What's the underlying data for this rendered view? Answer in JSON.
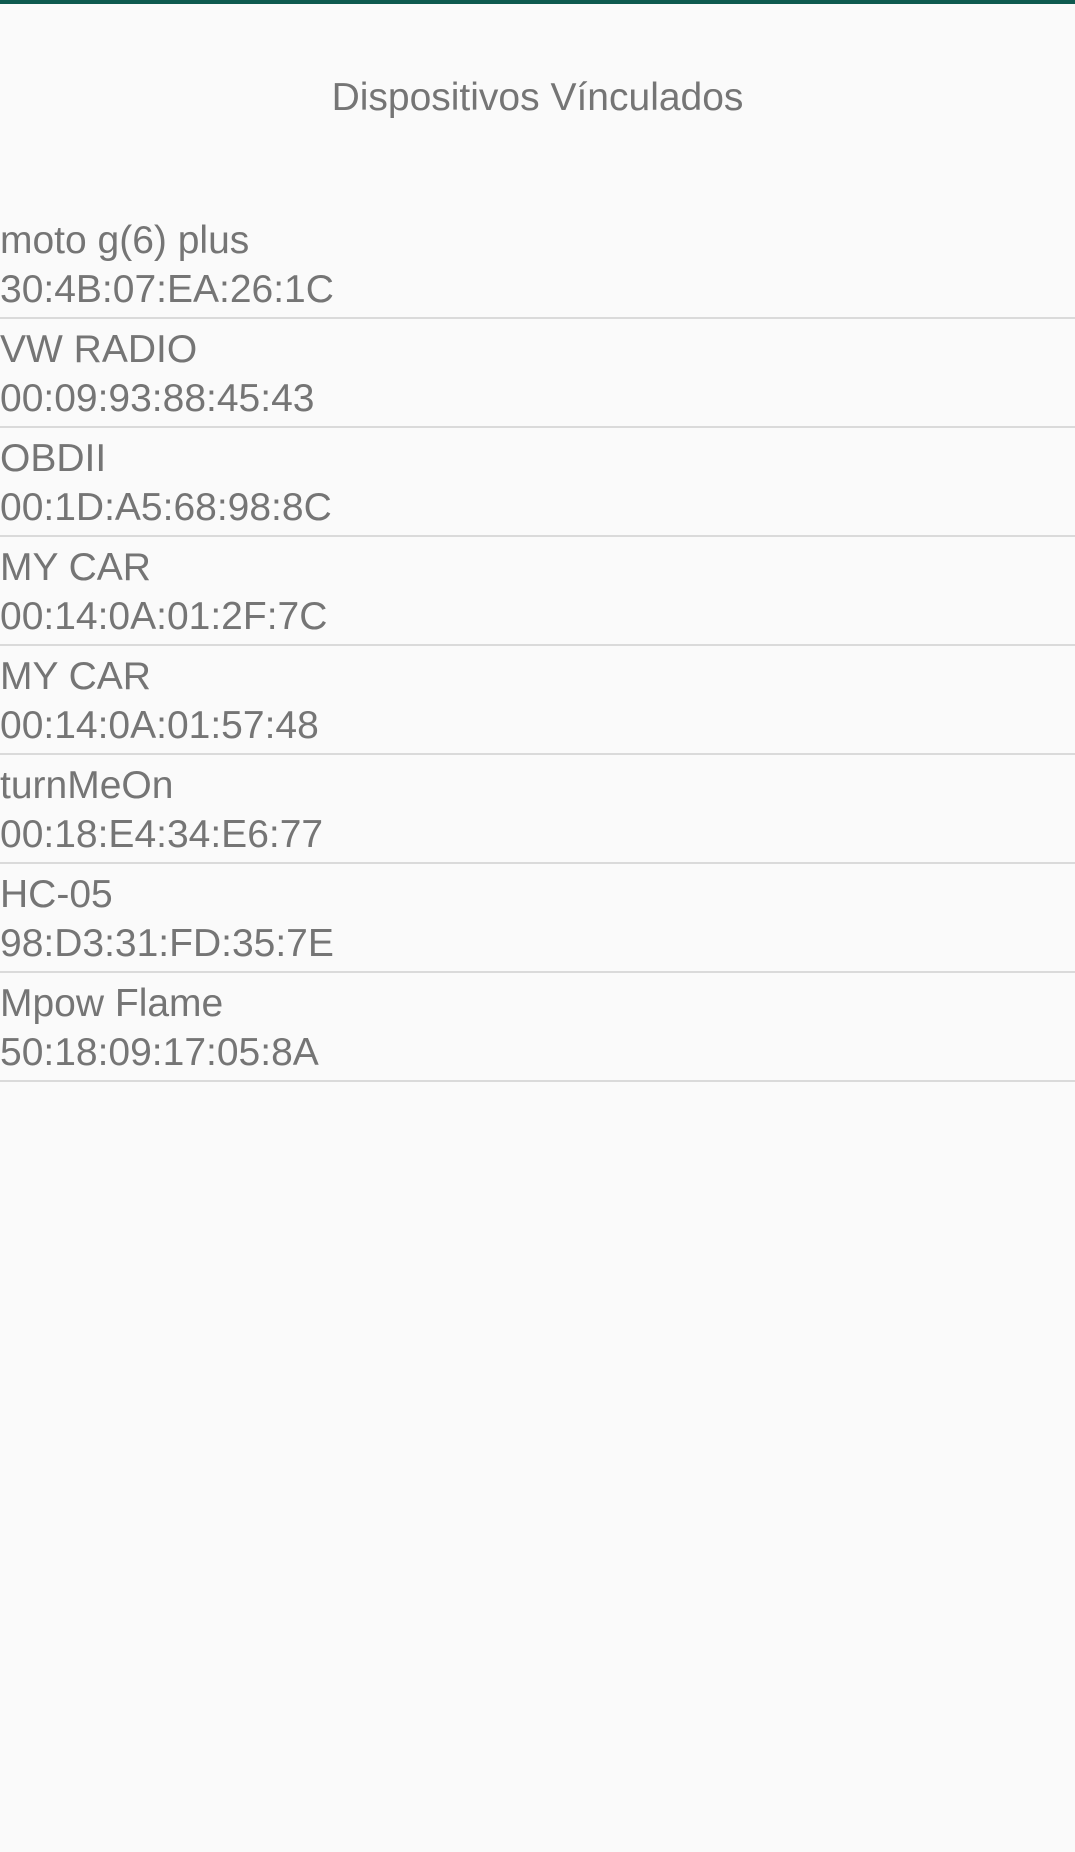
{
  "header": {
    "title": "Dispositivos Vínculados",
    "accent_color": "#0e5a4f"
  },
  "devices": [
    {
      "name": "moto g(6) plus",
      "address": "30:4B:07:EA:26:1C"
    },
    {
      "name": "VW RADIO",
      "address": "00:09:93:88:45:43"
    },
    {
      "name": "OBDII",
      "address": "00:1D:A5:68:98:8C"
    },
    {
      "name": "MY CAR",
      "address": "00:14:0A:01:2F:7C"
    },
    {
      "name": "MY CAR",
      "address": "00:14:0A:01:57:48"
    },
    {
      "name": "turnMeOn",
      "address": "00:18:E4:34:E6:77"
    },
    {
      "name": "HC-05",
      "address": "98:D3:31:FD:35:7E"
    },
    {
      "name": "Mpow Flame",
      "address": "50:18:09:17:05:8A"
    }
  ]
}
